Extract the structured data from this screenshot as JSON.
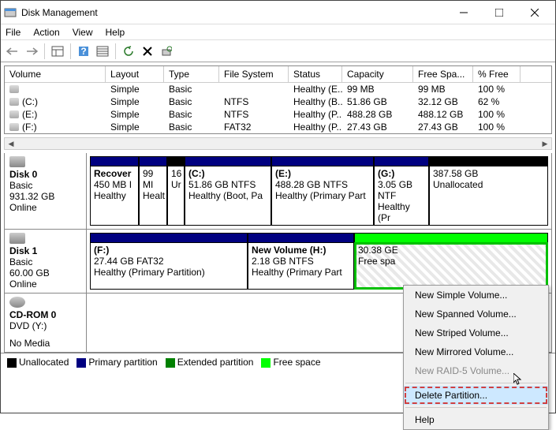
{
  "window": {
    "title": "Disk Management"
  },
  "menu": {
    "file": "File",
    "action": "Action",
    "view": "View",
    "help": "Help"
  },
  "table": {
    "headers": {
      "volume": "Volume",
      "layout": "Layout",
      "type": "Type",
      "fs": "File System",
      "status": "Status",
      "capacity": "Capacity",
      "free": "Free Spa...",
      "pct": "% Free"
    },
    "rows": [
      {
        "vol": "",
        "layout": "Simple",
        "type": "Basic",
        "fs": "",
        "status": "Healthy (E...",
        "cap": "99 MB",
        "free": "99 MB",
        "pct": "100 %"
      },
      {
        "vol": "(C:)",
        "layout": "Simple",
        "type": "Basic",
        "fs": "NTFS",
        "status": "Healthy (B...",
        "cap": "51.86 GB",
        "free": "32.12 GB",
        "pct": "62 %"
      },
      {
        "vol": "(E:)",
        "layout": "Simple",
        "type": "Basic",
        "fs": "NTFS",
        "status": "Healthy (P...",
        "cap": "488.28 GB",
        "free": "488.12 GB",
        "pct": "100 %"
      },
      {
        "vol": "(F:)",
        "layout": "Simple",
        "type": "Basic",
        "fs": "FAT32",
        "status": "Healthy (P...",
        "cap": "27.43 GB",
        "free": "27.43 GB",
        "pct": "100 %"
      }
    ]
  },
  "disk0": {
    "name": "Disk 0",
    "type": "Basic",
    "size": "931.32 GB",
    "state": "Online",
    "p1": {
      "a": "Recover",
      "b": "450 MB I",
      "c": "Healthy"
    },
    "p2": {
      "a": "",
      "b": "99 MI",
      "c": "Healt"
    },
    "p3": {
      "a": "",
      "b": "16",
      "c": "Ur"
    },
    "p4": {
      "a": "(C:)",
      "b": "51.86 GB NTFS",
      "c": "Healthy (Boot, Pa"
    },
    "p5": {
      "a": "(E:)",
      "b": "488.28 GB NTFS",
      "c": "Healthy (Primary Part"
    },
    "p6": {
      "a": "(G:)",
      "b": "3.05 GB NTF",
      "c": "Healthy (Pr"
    },
    "p7": {
      "a": "",
      "b": "387.58 GB",
      "c": "Unallocated"
    }
  },
  "disk1": {
    "name": "Disk 1",
    "type": "Basic",
    "size": "60.00 GB",
    "state": "Online",
    "p1": {
      "a": "(F:)",
      "b": "27.44 GB FAT32",
      "c": "Healthy (Primary Partition)"
    },
    "p2": {
      "a": "New Volume  (H:)",
      "b": "2.18 GB NTFS",
      "c": "Healthy (Primary Part"
    },
    "p3": {
      "a": "",
      "b": "30.38 GE",
      "c": "Free spa"
    }
  },
  "cdrom": {
    "name": "CD-ROM 0",
    "sub": "DVD (Y:)",
    "state": "No Media"
  },
  "legend": {
    "unalloc": "Unallocated",
    "primary": "Primary partition",
    "ext": "Extended partition",
    "free": "Free space"
  },
  "ctx": {
    "i1": "New Simple Volume...",
    "i2": "New Spanned Volume...",
    "i3": "New Striped Volume...",
    "i4": "New Mirrored Volume...",
    "i5": "New RAID-5 Volume...",
    "i6": "Delete Partition...",
    "i7": "Help"
  }
}
